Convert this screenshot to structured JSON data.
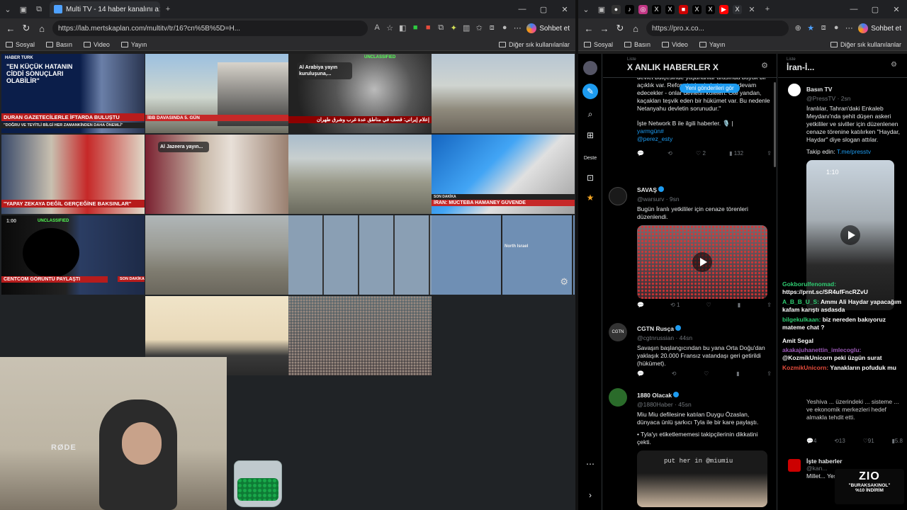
{
  "left_window": {
    "tab_title": "Multi TV - 14 haber kanalını a",
    "url": "https://lab.mertskaplan.com/multitv/tr/16?cn%5B%5D=H...",
    "sohbet": "Sohbet et",
    "bookmarks": [
      "Sosyal",
      "Basın",
      "Video",
      "Yayın"
    ],
    "other_bookmarks": "Diğer sık kullanılanlar"
  },
  "right_window": {
    "url": "https://pro.x.co...",
    "sohbet": "Sohbet et",
    "bookmarks": [
      "Sosyal",
      "Basın",
      "Video",
      "Yayın"
    ],
    "other_bookmarks": "Diğer sık kullanılanlar"
  },
  "tv_cells": {
    "c1": {
      "head": "\"EN KÜÇÜK HATANIN CİDDİ SONUÇLARI OLABİLİR\"",
      "tag": "HABER TÜRK",
      "lower": "DURAN GAZETECİLERLE İFTARDA BULUŞTU",
      "sub": "\"DOĞRU VE TEYİTLİ BİLGİ HER ZAMANKİNDEN DAHA ÖNEMLİ\""
    },
    "c2": {
      "lower": "İBB DAVASINDA 5. GÜN"
    },
    "c3": {
      "badge": "UNCLASSIFIED",
      "pop": "Al Arabiya yayın kuruluşuna,...",
      "lower": "إعلام إيراني: قصف في مناطق عدة غرب وشرق طهران"
    },
    "c5": {
      "lower": "\"YAPAY ZEKAYA DEĞİL GERÇEĞİNE BAKSINLAR\""
    },
    "c6": {
      "pop": "Al Jazeera yayın..."
    },
    "c8": {
      "lower": "İRAN: MÜCTEBA HAMANEY GÜVENDE",
      "tag": "SON DAKİKA"
    },
    "c9": {
      "time": "1:00",
      "badge": "UNCLASSIFIED",
      "lower": "CENTCOM GÖRÜNTÜ PAYLAŞTI",
      "tag": "SON DAKİKA"
    },
    "c12": {
      "label": "North Israel"
    }
  },
  "cam": {
    "mic": "RØDE"
  },
  "x": {
    "col1": {
      "label": "Liste",
      "title": "X ANLIK HABERLER X",
      "new_posts": "Yeni gönderileri gör",
      "p0_text": "devlet bütçesinde yaşananlar arasında büyük bir açıklık var. Reformist kesimleri tmeye devam edecekler - onlar devletin köleleri. Öte yandan, kaçakları teşvik eden bir hükümet var. Bu nedenle Netanyahu devletin sorunudur.\"",
      "p0_line2": "İşte Network B ile ilgili haberler. 🎙️ |",
      "p0_links": "yarmgün#\n@perez_esty",
      "p0_actions": {
        "likes": "2",
        "views": "132"
      },
      "p1": {
        "name": "SAVAŞ",
        "handle": "@warsurv · 9sn",
        "text": "Bugün İranlı yetkililer için cenaze törenleri düzenlendi.",
        "reposts": "1"
      },
      "p2": {
        "name": "CGTN Rusça",
        "handle": "@cgtnrussian · 44sn",
        "text": "Savaşın başlangıcından bu yana Orta Doğu'dan yaklaşık 20.000 Fransız vatandaşı geri getirildi (hükümet)."
      },
      "p3": {
        "name": "1880 Olacak",
        "handle": "@1880Haber · 45sn",
        "text": "Miu Miu defilesine katılan Duygu Özaslan, dünyaca ünlü şarkıcı Tyla ile bir kare paylaştı.",
        "text2": "• Tyla'yı etiketlememesi takipçilerinin dikkatini çekti.",
        "media_text": "put her in @miumiu"
      }
    },
    "col2": {
      "label": "Liste",
      "title": "İran-İ...",
      "p1": {
        "name": "Basın TV",
        "handle": "@PressTV · 2sn",
        "text": "İranlılar, Tahran'daki Enkaleb Meydanı'nda şehit düşen askeri yetkililer ve siviller için düzenlenen cenaze törenine katılırken \"Haydar, Haydar\" diye slogan attılar.",
        "follow": "Takip edin:",
        "follow_link": "T.me/presstv",
        "time": "1:10"
      },
      "chat": [
        {
          "user": "Gokborulfenomad:",
          "msg": "https://prnt.sc/SR4ufFncRZvU"
        },
        {
          "user": "A_B_B_U_S:",
          "msg": "Ammı Ali Haydar yapacağım kafam karıştı asdasda"
        },
        {
          "user": "bilgekulkaan:",
          "msg": "biz nereden bakıyoruz mateme chat ?"
        },
        {
          "user": "Amit Segal",
          "msg": ""
        },
        {
          "user": "akakajuhanettin_imlecoglu:",
          "msg": "@KozmikUnicorn peki üzgün surat"
        },
        {
          "user": "KozmikUnicorn:",
          "msg": "Yanakların pofuduk mu"
        }
      ],
      "reply_text": "Yeshiva ... üzerindeki ... sisteme ... ve ekonomik merkezleri hedef almakla tehdit etti.",
      "actions": {
        "replies": "4",
        "reposts": "13",
        "likes": "91",
        "views": "5.8"
      },
      "p2": {
        "name": "İşte haberler",
        "handle": "@kan...",
        "text": "Millet... Yesh... pilot..."
      },
      "zio": {
        "brand": "ZIO",
        "code": "\"BURAKSAKINOL\"",
        "promo": "%10 İNDİRİM"
      }
    }
  }
}
